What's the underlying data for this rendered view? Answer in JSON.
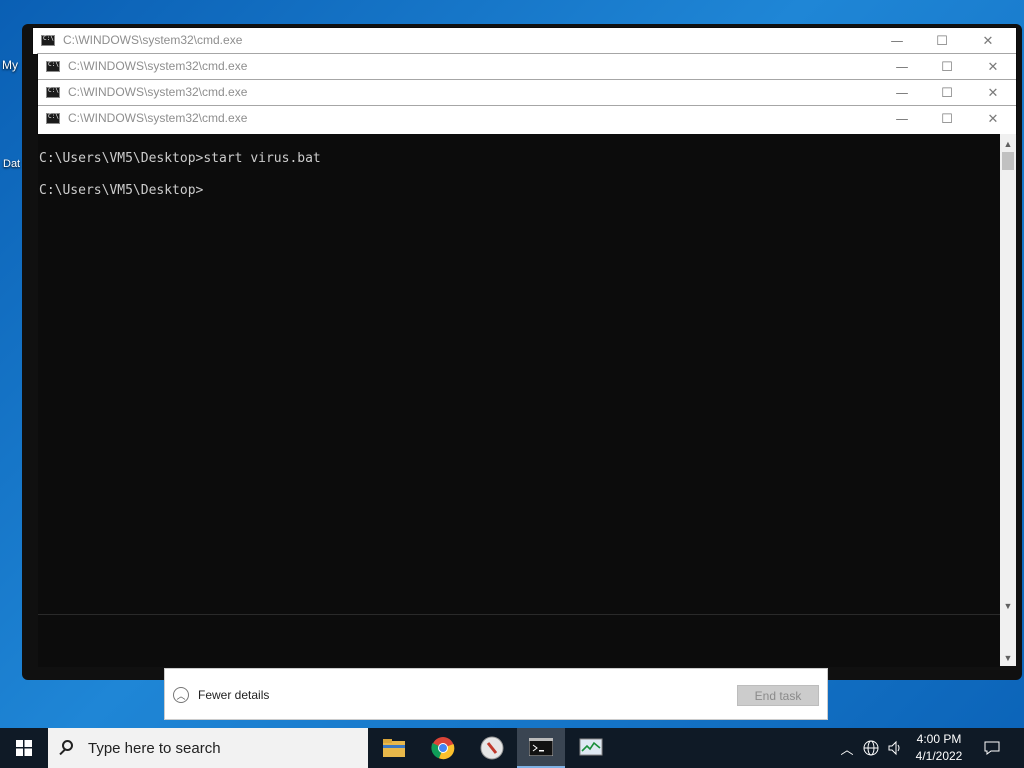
{
  "desktop": {
    "icon_labels": [
      "My",
      "Dat"
    ]
  },
  "windows": [
    {
      "title": "C:\\WINDOWS\\system32\\cmd.exe"
    },
    {
      "title": "C:\\WINDOWS\\system32\\cmd.exe"
    },
    {
      "title": "C:\\WINDOWS\\system32\\cmd.exe"
    },
    {
      "title": "C:\\WINDOWS\\system32\\cmd.exe"
    }
  ],
  "window_controls": {
    "minimize": "—",
    "maximize": "☐",
    "close": "✕"
  },
  "console": {
    "lines": [
      "C:\\Users\\VM5\\Desktop>start virus.bat",
      "C:\\Users\\VM5\\Desktop>"
    ]
  },
  "task_manager": {
    "fewer_details_label": "Fewer details",
    "end_task_label": "End task"
  },
  "taskbar": {
    "search_placeholder": "Type here to search",
    "apps": [
      "file-explorer-icon",
      "chrome-icon",
      "app-icon",
      "cmd-icon",
      "task-manager-icon"
    ],
    "clock_time": "4:00 PM",
    "clock_date": "4/1/2022"
  }
}
